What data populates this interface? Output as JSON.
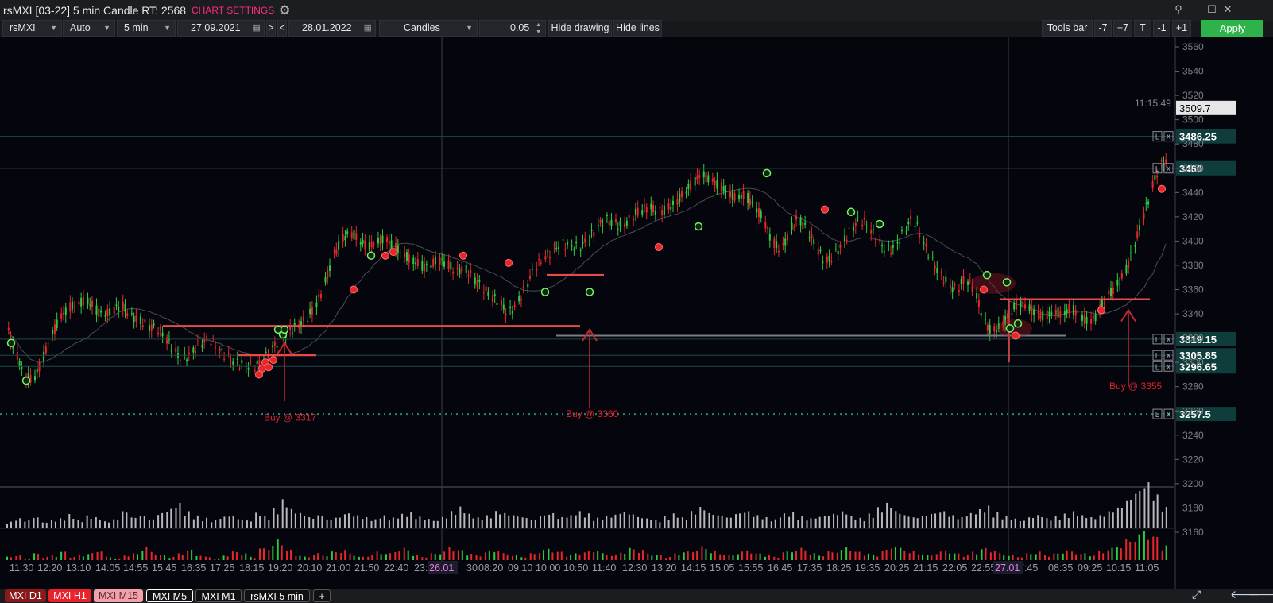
{
  "window": {
    "title": "rsMXI [03-22] 5 min Candle RT: 2568",
    "settings_label": "CHART SETTINGS",
    "icons": [
      "gear-icon",
      "pin-icon",
      "minimize-icon",
      "maximize-icon",
      "close-icon"
    ]
  },
  "toolbar": {
    "symbol": "rsMXI",
    "scale": "Auto",
    "timeframe": "5 min",
    "date_from": "27.09.2021",
    "next_label": ">",
    "prev_label": "<",
    "date_to": "28.01.2022",
    "chart_type": "Candles",
    "step": "0.05",
    "hide_drawing": "Hide drawing",
    "hide_lines": "Hide lines",
    "tools_bar": "Tools bar",
    "minus7": "-7",
    "plus7": "+7",
    "t": "T",
    "minus1": "-1",
    "plus1": "+1",
    "apply": "Apply"
  },
  "colors": {
    "bull": "#2ecc40",
    "bear": "#e8262b",
    "level_line": "#e84a4a",
    "apply": "#2eb24a",
    "settings": "#ff2e7a",
    "price_tag": "#0f3d3b"
  },
  "chart_data": {
    "type": "candlestick",
    "price_axis": {
      "min": 3150,
      "max": 3560,
      "ticks": [
        3560,
        3540,
        3520,
        3500,
        3480,
        3460,
        3440,
        3420,
        3400,
        3380,
        3360,
        3340,
        3320,
        3300,
        3280,
        3260,
        3240,
        3220,
        3200,
        3180,
        3160
      ]
    },
    "time_labels": [
      "11:30",
      "12:20",
      "13:10",
      "14:05",
      "14:55",
      "15:45",
      "16:35",
      "17:25",
      "18:15",
      "19:20",
      "20:10",
      "21:00",
      "21:50",
      "22:40",
      "23:",
      "30",
      "08:20",
      "09:10",
      "10:00",
      "10:50",
      "11:40",
      "12:30",
      "13:20",
      "14:15",
      "15:05",
      "15:55",
      "16:45",
      "17:35",
      "18:25",
      "19:35",
      "20:25",
      "21:15",
      "22:05",
      "22:55",
      "2",
      "7:45",
      "08:35",
      "09:25",
      "10:15",
      "11:05"
    ],
    "day_markers": [
      "26.01",
      "27.01"
    ],
    "clock": "11:15:49",
    "current_price": "3509.7",
    "price_levels": [
      {
        "label": "3486.25",
        "value": 3486.25
      },
      {
        "label": "3460",
        "value": 3460
      },
      {
        "label": "3319.15",
        "value": 3319.15
      },
      {
        "label": "3305.85",
        "value": 3305.85
      },
      {
        "label": "3296.65",
        "value": 3296.65
      },
      {
        "label": "3257.5",
        "value": 3257.5
      }
    ],
    "level_buttons": [
      "L",
      "X"
    ],
    "annotations": [
      {
        "text": "Buy @ 3317",
        "price": 3317
      },
      {
        "text": "Buy @ 3360",
        "price": 3360
      },
      {
        "text": "Buy @ 3355",
        "price": 3355
      }
    ],
    "close_path": [
      3330,
      3310,
      3290,
      3285,
      3300,
      3320,
      3335,
      3345,
      3348,
      3352,
      3345,
      3338,
      3342,
      3348,
      3340,
      3335,
      3330,
      3328,
      3322,
      3310,
      3302,
      3308,
      3315,
      3320,
      3312,
      3305,
      3300,
      3298,
      3296,
      3300,
      3310,
      3318,
      3325,
      3330,
      3335,
      3345,
      3360,
      3385,
      3400,
      3408,
      3402,
      3395,
      3398,
      3402,
      3396,
      3390,
      3385,
      3380,
      3378,
      3385,
      3382,
      3375,
      3378,
      3370,
      3362,
      3355,
      3350,
      3340,
      3348,
      3362,
      3378,
      3385,
      3392,
      3398,
      3396,
      3395,
      3400,
      3410,
      3418,
      3415,
      3412,
      3420,
      3425,
      3428,
      3424,
      3426,
      3432,
      3440,
      3448,
      3455,
      3450,
      3446,
      3440,
      3436,
      3438,
      3428,
      3418,
      3400,
      3392,
      3408,
      3420,
      3408,
      3396,
      3382,
      3388,
      3398,
      3410,
      3418,
      3412,
      3400,
      3392,
      3395,
      3408,
      3420,
      3402,
      3386,
      3374,
      3364,
      3360,
      3370,
      3360,
      3335,
      3325,
      3330,
      3340,
      3350,
      3345,
      3340,
      3338,
      3342,
      3340,
      3345,
      3338,
      3332,
      3340,
      3355,
      3362,
      3372,
      3392,
      3416,
      3440,
      3462,
      3468
    ],
    "volume": [
      3,
      5,
      4,
      6,
      3,
      4,
      5,
      7,
      4,
      6,
      5,
      3,
      4,
      8,
      5,
      6,
      4,
      7,
      9,
      12,
      8,
      6,
      5,
      4,
      6,
      7,
      5,
      4,
      8,
      6,
      10,
      14,
      9,
      7,
      5,
      6,
      4,
      5,
      7,
      6,
      5,
      4,
      6,
      5,
      7,
      8,
      6,
      5,
      4,
      6,
      9,
      11,
      7,
      5,
      6,
      8,
      7,
      6,
      5,
      4,
      6,
      7,
      5,
      6,
      8,
      7,
      5,
      6,
      7,
      9,
      8,
      6,
      5,
      4,
      6,
      7,
      5,
      8,
      10,
      7,
      6,
      5,
      7,
      8,
      6,
      5,
      4,
      7,
      8,
      6,
      5,
      6,
      7,
      8,
      9,
      6,
      5,
      7,
      10,
      12,
      8,
      6,
      5,
      6,
      7,
      8,
      6,
      5,
      7,
      9,
      11,
      8,
      6,
      5,
      4,
      6,
      7,
      5,
      6,
      7,
      8,
      6,
      5,
      6,
      8,
      10,
      14,
      18,
      22,
      16,
      10
    ],
    "indicator": [
      2,
      3,
      1,
      4,
      2,
      3,
      5,
      2,
      3,
      4,
      6,
      2,
      1,
      3,
      4,
      8,
      5,
      3,
      2,
      4,
      6,
      3,
      2,
      1,
      3,
      5,
      4,
      2,
      7,
      9,
      12,
      6,
      3,
      2,
      4,
      3,
      5,
      6,
      4,
      2,
      3,
      5,
      4,
      6,
      7,
      3,
      2,
      4,
      5,
      8,
      6,
      4,
      3,
      5,
      6,
      4,
      3,
      2,
      4,
      6,
      7,
      5,
      3,
      4,
      5,
      6,
      4,
      3,
      5,
      7,
      6,
      4,
      3,
      2,
      4,
      5,
      6,
      8,
      5,
      4,
      3,
      5,
      6,
      4,
      3,
      2,
      5,
      6,
      7,
      4,
      3,
      5,
      6,
      8,
      5,
      4,
      3,
      6,
      9,
      7,
      5,
      4,
      3,
      5,
      6,
      4,
      3,
      5,
      7,
      6,
      4,
      3,
      2,
      4,
      5,
      3,
      4,
      6,
      5,
      4,
      3,
      5,
      7,
      9,
      12,
      15,
      18,
      14,
      9
    ]
  },
  "tabs": [
    {
      "label": "MXI D1",
      "active": false
    },
    {
      "label": "MXI H1",
      "active": false
    },
    {
      "label": "MXI M15",
      "active": false
    },
    {
      "label": "MXI M5",
      "active": true
    },
    {
      "label": "MXI M1",
      "active": false
    },
    {
      "label": "rsMXI 5 min",
      "active": false
    },
    {
      "label": "+",
      "active": false
    }
  ],
  "bottom_icons": [
    "expand-icon",
    "scroll-left-icon",
    "scroll-right-icon"
  ]
}
